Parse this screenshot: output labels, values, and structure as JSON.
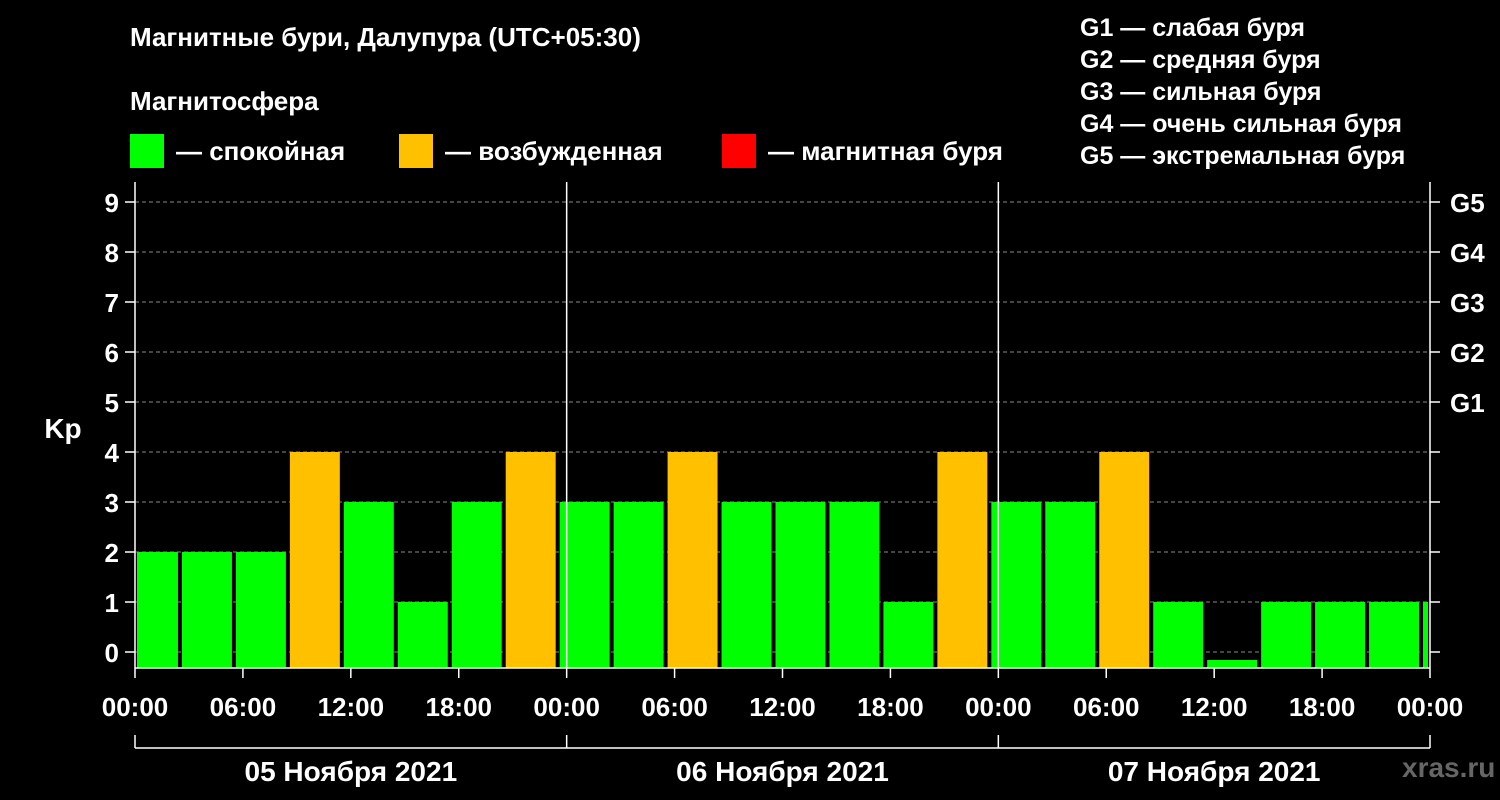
{
  "title": "Магнитные бури, Далупура (UTC+05:30)",
  "subtitle": "Магнитосфера",
  "legend": [
    {
      "color": "#00ff00",
      "label": "— спокойная"
    },
    {
      "color": "#ffc000",
      "label": "— возбужденная"
    },
    {
      "color": "#ff0000",
      "label": "— магнитная буря"
    }
  ],
  "g_levels": [
    "G1 — слабая буря",
    "G2 — средняя буря",
    "G3 — сильная буря",
    "G4 — очень сильная буря",
    "G5 — экстремальная буря"
  ],
  "watermark": "xras.ru",
  "chart_data": {
    "type": "bar",
    "ylabel": "Kp",
    "ylim": [
      0,
      9
    ],
    "yticks": [
      0,
      1,
      2,
      3,
      4,
      5,
      6,
      7,
      8,
      9
    ],
    "right_ticks": [
      {
        "value": 5,
        "label": "G1"
      },
      {
        "value": 6,
        "label": "G2"
      },
      {
        "value": 7,
        "label": "G3"
      },
      {
        "value": 8,
        "label": "G4"
      },
      {
        "value": 9,
        "label": "G5"
      }
    ],
    "x_tick_labels": [
      "00:00",
      "06:00",
      "12:00",
      "18:00",
      "00:00",
      "06:00",
      "12:00",
      "18:00",
      "00:00",
      "06:00",
      "12:00",
      "18:00",
      "00:00"
    ],
    "days": [
      "05 Ноября 2021",
      "06 Ноября 2021",
      "07 Ноября 2021"
    ],
    "colors": {
      "quiet": "#00ff00",
      "active": "#ffc000",
      "storm": "#ff0000"
    },
    "bars": [
      {
        "start_hour": 0,
        "end_hour": 2.5,
        "kp": 2,
        "state": "quiet"
      },
      {
        "start_hour": 2.5,
        "end_hour": 5.5,
        "kp": 2,
        "state": "quiet"
      },
      {
        "start_hour": 5.5,
        "end_hour": 8.5,
        "kp": 2,
        "state": "quiet"
      },
      {
        "start_hour": 8.5,
        "end_hour": 11.5,
        "kp": 4,
        "state": "active"
      },
      {
        "start_hour": 11.5,
        "end_hour": 14.5,
        "kp": 3,
        "state": "quiet"
      },
      {
        "start_hour": 14.5,
        "end_hour": 17.5,
        "kp": 1,
        "state": "quiet"
      },
      {
        "start_hour": 17.5,
        "end_hour": 20.5,
        "kp": 3,
        "state": "quiet"
      },
      {
        "start_hour": 20.5,
        "end_hour": 23.5,
        "kp": 4,
        "state": "active"
      },
      {
        "start_hour": 23.5,
        "end_hour": 26.5,
        "kp": 3,
        "state": "quiet"
      },
      {
        "start_hour": 26.5,
        "end_hour": 29.5,
        "kp": 3,
        "state": "quiet"
      },
      {
        "start_hour": 29.5,
        "end_hour": 32.5,
        "kp": 4,
        "state": "active"
      },
      {
        "start_hour": 32.5,
        "end_hour": 35.5,
        "kp": 3,
        "state": "quiet"
      },
      {
        "start_hour": 35.5,
        "end_hour": 38.5,
        "kp": 3,
        "state": "quiet"
      },
      {
        "start_hour": 38.5,
        "end_hour": 41.5,
        "kp": 3,
        "state": "quiet"
      },
      {
        "start_hour": 41.5,
        "end_hour": 44.5,
        "kp": 1,
        "state": "quiet"
      },
      {
        "start_hour": 44.5,
        "end_hour": 47.5,
        "kp": 4,
        "state": "active"
      },
      {
        "start_hour": 47.5,
        "end_hour": 50.5,
        "kp": 3,
        "state": "quiet"
      },
      {
        "start_hour": 50.5,
        "end_hour": 53.5,
        "kp": 3,
        "state": "quiet"
      },
      {
        "start_hour": 53.5,
        "end_hour": 56.5,
        "kp": 4,
        "state": "active"
      },
      {
        "start_hour": 56.5,
        "end_hour": 59.5,
        "kp": 1,
        "state": "quiet"
      },
      {
        "start_hour": 59.5,
        "end_hour": 62.5,
        "kp": 0,
        "state": "quiet"
      },
      {
        "start_hour": 62.5,
        "end_hour": 65.5,
        "kp": 1,
        "state": "quiet"
      },
      {
        "start_hour": 65.5,
        "end_hour": 68.5,
        "kp": 1,
        "state": "quiet"
      },
      {
        "start_hour": 68.5,
        "end_hour": 71.5,
        "kp": 1,
        "state": "quiet"
      },
      {
        "start_hour": 71.5,
        "end_hour": 72,
        "kp": 1,
        "state": "quiet"
      }
    ]
  }
}
